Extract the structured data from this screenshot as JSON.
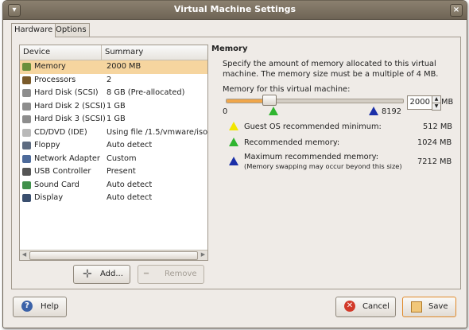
{
  "window": {
    "title": "Virtual Machine Settings",
    "close_symbol": "×"
  },
  "tabs": [
    {
      "label": "Hardware",
      "active": true
    },
    {
      "label": "Options",
      "active": false
    }
  ],
  "device_list": {
    "columns": [
      "Device",
      "Summary"
    ],
    "rows": [
      {
        "device": "Memory",
        "summary": "2000 MB",
        "icon": "memory-icon",
        "selected": true
      },
      {
        "device": "Processors",
        "summary": "2",
        "icon": "processor-icon"
      },
      {
        "device": "Hard Disk (SCSI)",
        "summary": "8 GB (Pre-allocated)",
        "icon": "hard-disk-icon"
      },
      {
        "device": "Hard Disk 2 (SCSI)",
        "summary": "1 GB",
        "icon": "hard-disk-icon"
      },
      {
        "device": "Hard Disk 3 (SCSI)",
        "summary": "1 GB",
        "icon": "hard-disk-icon"
      },
      {
        "device": "CD/DVD (IDE)",
        "summary": "Using file /1.5/vmware/iso/",
        "icon": "cd-dvd-icon"
      },
      {
        "device": "Floppy",
        "summary": "Auto detect",
        "icon": "floppy-icon"
      },
      {
        "device": "Network Adapter",
        "summary": "Custom",
        "icon": "network-adapter-icon"
      },
      {
        "device": "USB Controller",
        "summary": "Present",
        "icon": "usb-icon"
      },
      {
        "device": "Sound Card",
        "summary": "Auto detect",
        "icon": "sound-card-icon"
      },
      {
        "device": "Display",
        "summary": "Auto detect",
        "icon": "display-icon"
      }
    ]
  },
  "list_buttons": {
    "add": "Add...",
    "remove": "Remove"
  },
  "memory": {
    "heading": "Memory",
    "description": "Specify the amount of memory allocated to this virtual machine. The memory size must be a multiple of 4 MB.",
    "slider_label": "Memory for this virtual machine:",
    "slider_min": "0",
    "slider_max": "8192",
    "value": "2000",
    "unit": "MB",
    "slider_fraction": 0.244,
    "legend": [
      {
        "label": "Guest OS recommended minimum:",
        "value": "512 MB",
        "color": "#f2e600"
      },
      {
        "label": "Recommended memory:",
        "value": "1024 MB",
        "color": "#2fb52f"
      },
      {
        "label": "Maximum recommended memory:",
        "note": "(Memory swapping may occur beyond this size)",
        "value": "7212 MB",
        "color": "#1b2fa8"
      }
    ]
  },
  "footer": {
    "help": "Help",
    "cancel": "Cancel",
    "save": "Save"
  }
}
